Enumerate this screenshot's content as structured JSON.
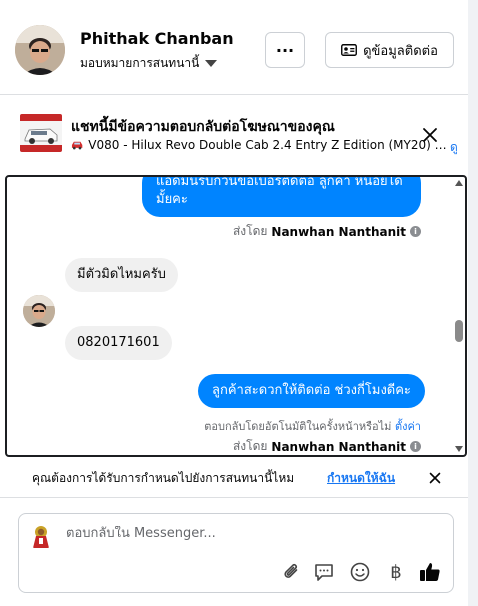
{
  "header": {
    "user_name": "Phithak Chanban",
    "assign_label": "มอบหมายการสนทนานี้",
    "more_label": "···",
    "contact_label": "ดูข้อมูลติดต่อ"
  },
  "ad_reply": {
    "title": "แชทนี้มีข้อความตอบกลับต่อโฆษณาของคุณ",
    "subtitle": "V080 - Hilux Revo Double Cab 2.4 Entry Z Edition (MY20) MT*...",
    "link_label": "ดู"
  },
  "messages": {
    "out1_text": "แอดมินรบกวนขอเบอร์ติดต่อ ลูกค้า หน่อยได้มั้ยคะ",
    "sent_by_label_1": "ส่งโดย",
    "sender_1": "Nanwhan Nanthanit",
    "in1_text": "มีตัวมิดไหมครับ",
    "in2_text": "0820171601",
    "out2_text": "ลูกค้าสะดวกให้ติดต่อ ช่วงกี่โมงดีคะ",
    "autoreply_text": "ตอบกลับโดยอัตโนมัติในครั้งหน้าหรือไม่",
    "autoreply_link": "ตั้งค่า",
    "sent_by_label_2": "ส่งโดย",
    "sender_2": "Nanwhan Nanthanit"
  },
  "assign_prompt": {
    "text": "คุณต้องการได้รับการกำหนดไปยังการสนทนานี้ไหม",
    "link": "กำหนดให้ฉัน"
  },
  "composer": {
    "placeholder": "ตอบกลับใน Messenger...",
    "baht_symbol": "฿"
  },
  "colors": {
    "accent": "#0084ff",
    "link": "#1877f2",
    "incoming_bubble": "#f0f0f0"
  }
}
